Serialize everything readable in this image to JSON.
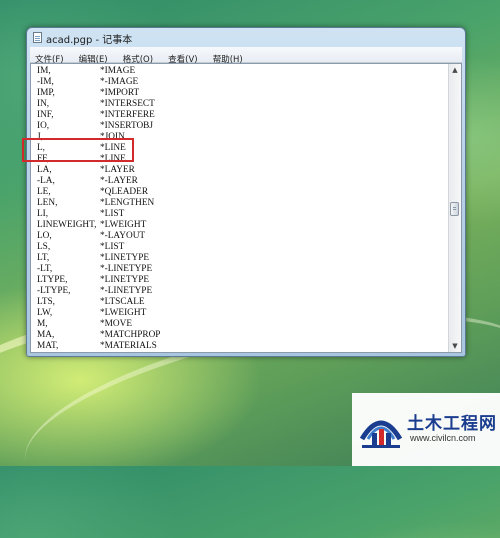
{
  "window": {
    "title": "acad.pgp - 记事本",
    "menu": [
      "文件(F)",
      "编辑(E)",
      "格式(O)",
      "查看(V)",
      "帮助(H)"
    ]
  },
  "document": {
    "lines": [
      {
        "cmd": "IM,",
        "alias": "*IMAGE"
      },
      {
        "cmd": "-IM,",
        "alias": "*-IMAGE"
      },
      {
        "cmd": "IMP,",
        "alias": "*IMPORT"
      },
      {
        "cmd": "IN,",
        "alias": "*INTERSECT"
      },
      {
        "cmd": "INF,",
        "alias": "*INTERFERE"
      },
      {
        "cmd": "IO,",
        "alias": "*INSERTOBJ"
      },
      {
        "cmd": "J,",
        "alias": "*JOIN"
      },
      {
        "cmd": "L,",
        "alias": "*LINE"
      },
      {
        "cmd": "FF,",
        "alias": "*LINE"
      },
      {
        "cmd": "LA,",
        "alias": "*LAYER"
      },
      {
        "cmd": "-LA,",
        "alias": "*-LAYER"
      },
      {
        "cmd": "LE,",
        "alias": "*QLEADER"
      },
      {
        "cmd": "LEN,",
        "alias": "*LENGTHEN"
      },
      {
        "cmd": "LI,",
        "alias": "*LIST"
      },
      {
        "cmd": "LINEWEIGHT,",
        "alias": "*LWEIGHT"
      },
      {
        "cmd": "LO,",
        "alias": "*-LAYOUT"
      },
      {
        "cmd": "LS,",
        "alias": "*LIST"
      },
      {
        "cmd": "LT,",
        "alias": "*LINETYPE"
      },
      {
        "cmd": "-LT,",
        "alias": "*-LINETYPE"
      },
      {
        "cmd": "LTYPE,",
        "alias": "*LINETYPE"
      },
      {
        "cmd": "-LTYPE,",
        "alias": "*-LINETYPE"
      },
      {
        "cmd": "LTS,",
        "alias": "*LTSCALE"
      },
      {
        "cmd": "LW,",
        "alias": "*LWEIGHT"
      },
      {
        "cmd": "M,",
        "alias": "*MOVE"
      },
      {
        "cmd": "MA,",
        "alias": "*MATCHPROP"
      },
      {
        "cmd": "MAT,",
        "alias": "*MATERIALS"
      }
    ]
  },
  "watermark": {
    "name": "土木工程网",
    "url": "www.civilcn.com"
  },
  "colors": {
    "highlight": "#d22a2a",
    "brand": "#1b3d8f"
  }
}
